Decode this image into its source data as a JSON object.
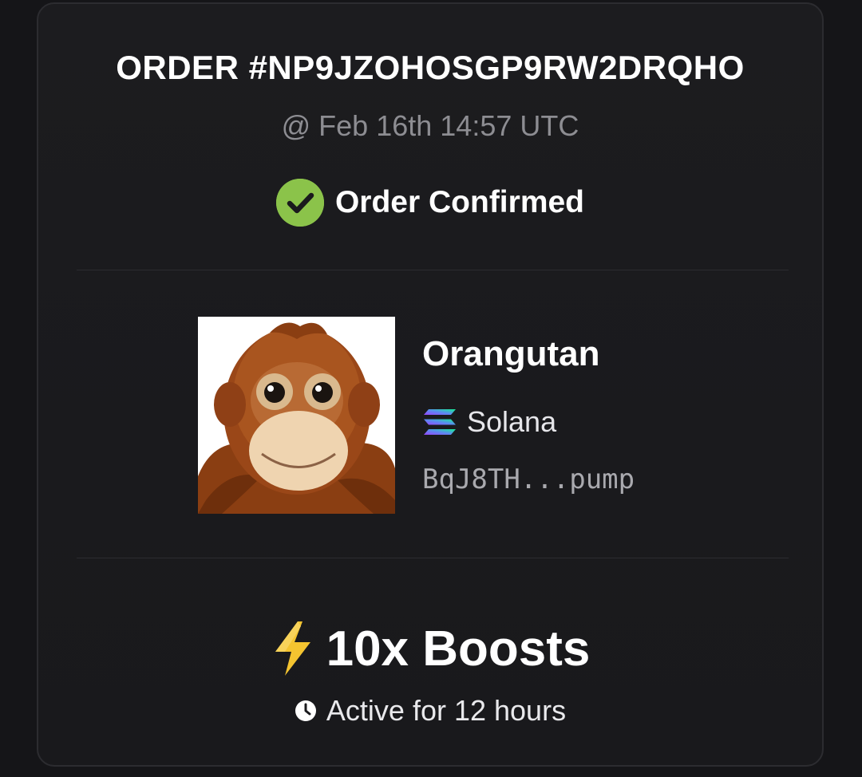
{
  "order": {
    "title": "ORDER #NP9JZOHOSGP9RW2DRQHO",
    "timestamp": "@ Feb 16th 14:57 UTC",
    "status": "Order Confirmed",
    "status_color": "#8bc34a"
  },
  "token": {
    "name": "Orangutan",
    "chain": "Solana",
    "address": "BqJ8TH...pump",
    "image_icon": "orangutan-plush-image",
    "chain_icon": "solana-icon"
  },
  "boost": {
    "label": "10x Boosts",
    "duration": "Active for 12 hours",
    "icon": "lightning-icon",
    "icon_color": "#f4c430"
  }
}
